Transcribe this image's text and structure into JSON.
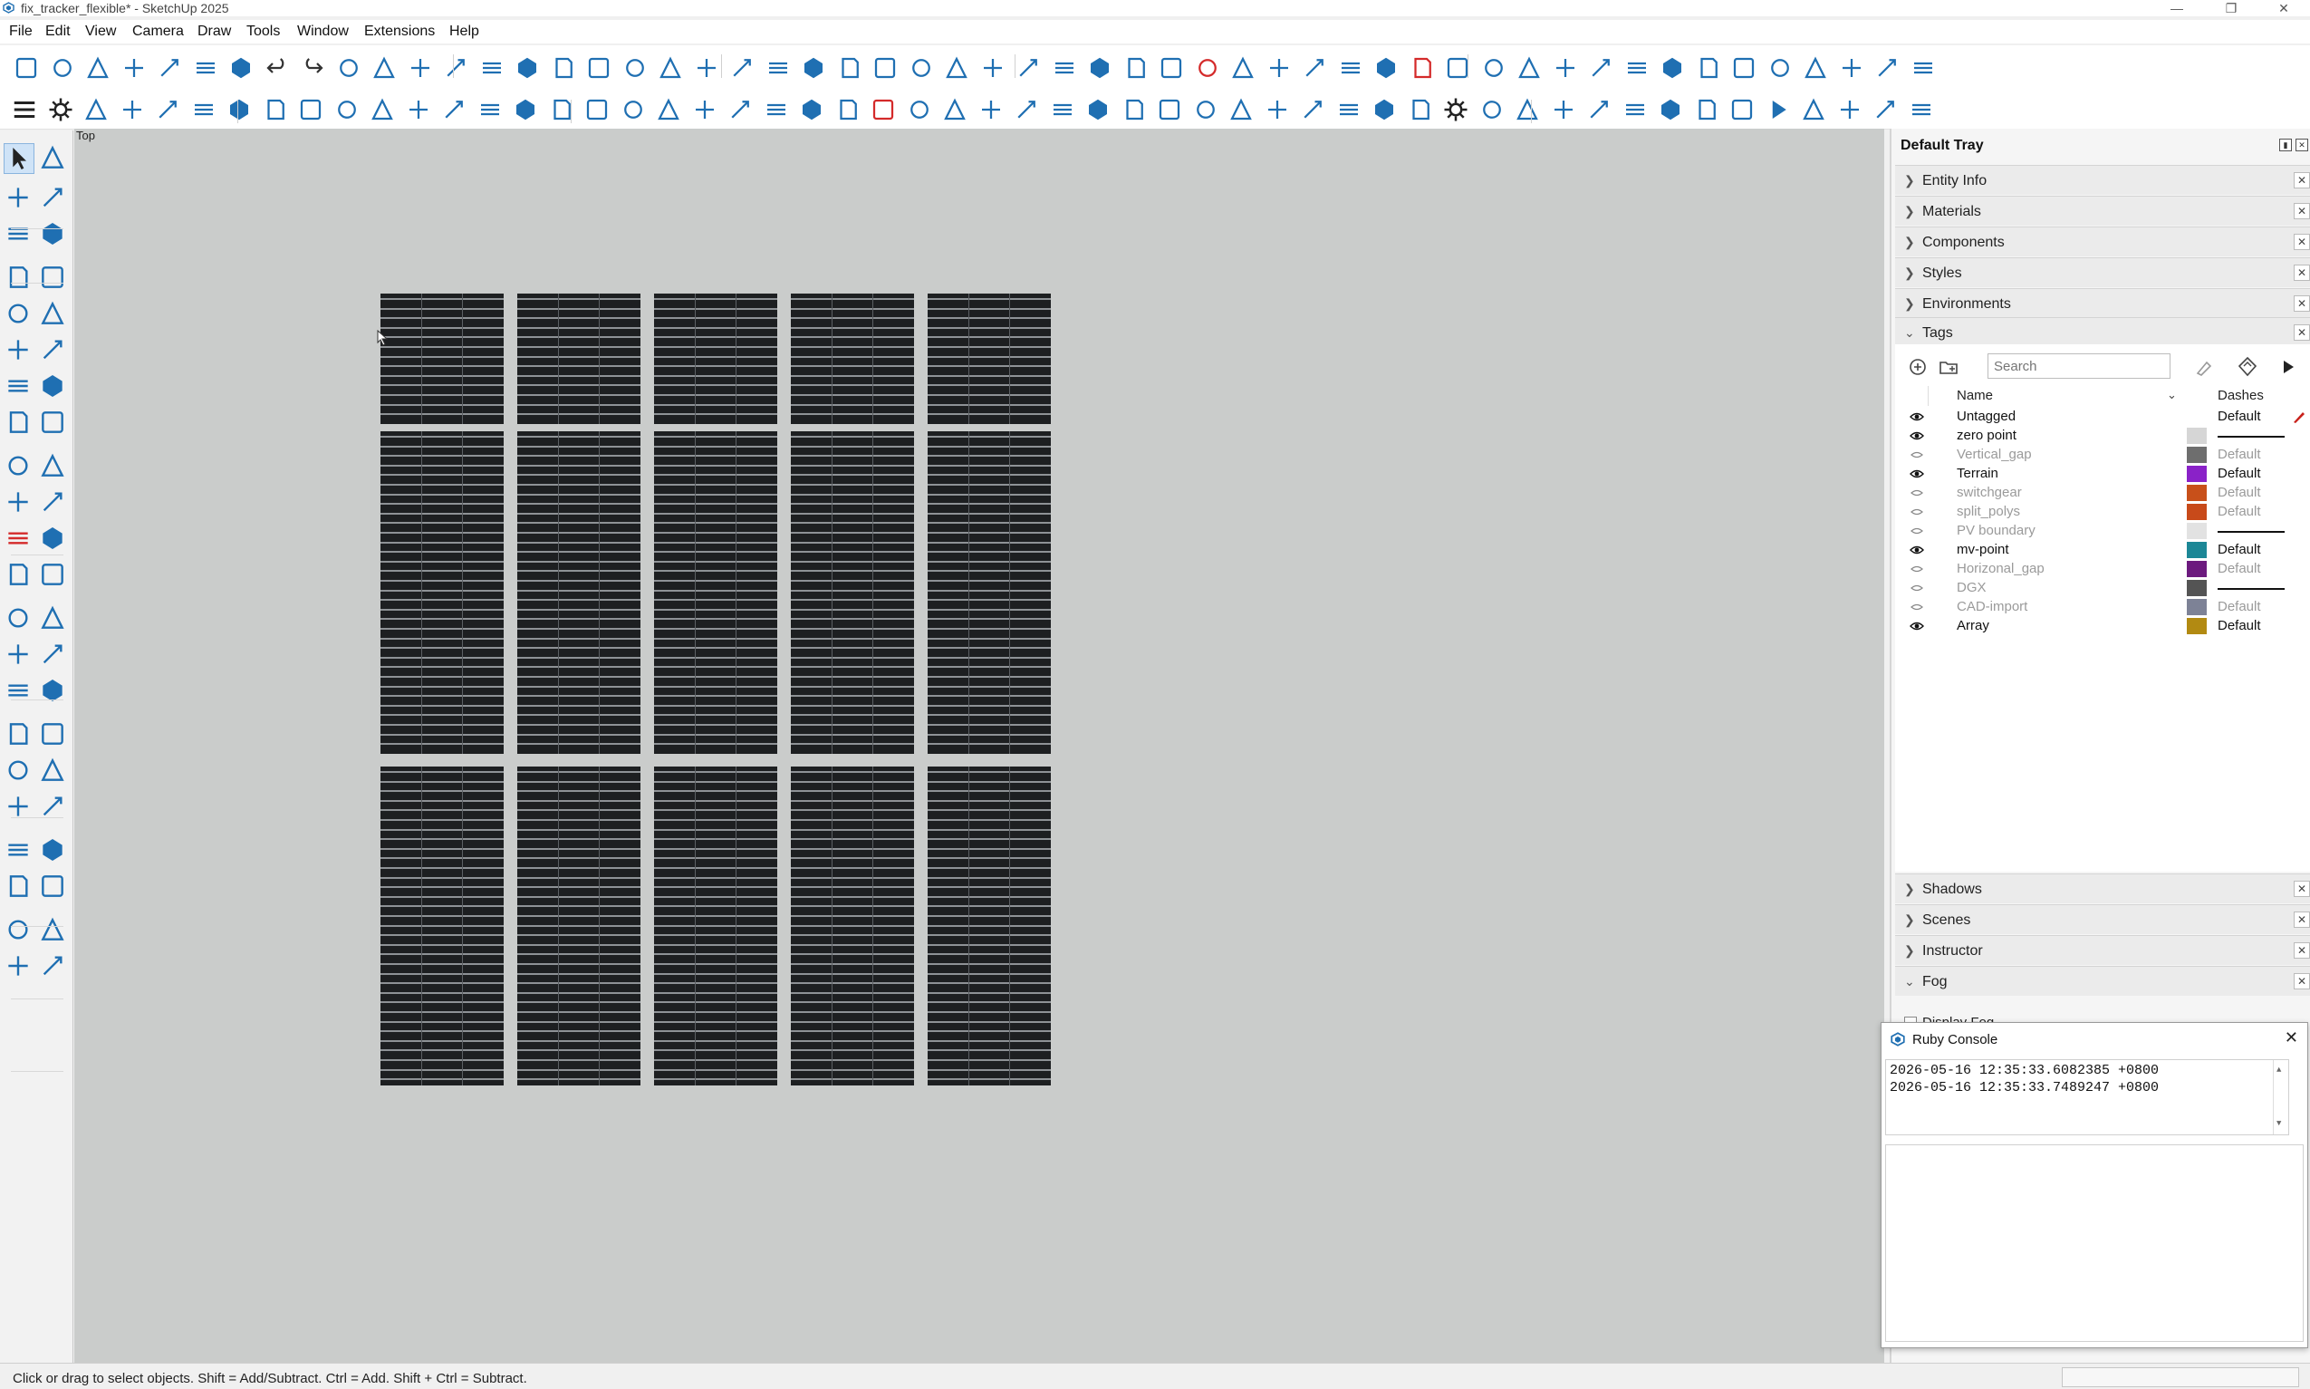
{
  "window": {
    "title": "fix_tracker_flexible* - SketchUp 2025",
    "controls": [
      "—",
      "❐",
      "✕"
    ]
  },
  "menu": [
    "File",
    "Edit",
    "View",
    "Camera",
    "Draw",
    "Tools",
    "Window",
    "Extensions",
    "Help"
  ],
  "colors": {
    "accent": "#1f6fb2",
    "viewport_bg": "#cacccb",
    "array_block": "#1d1f21",
    "red_tool": "#d42a2a"
  },
  "toolbar_icons": {
    "row1": [
      "new-file-icon",
      "open-file-icon",
      "save-icon",
      "cut-icon",
      "copy-icon",
      "paste-icon",
      "erase-icon",
      "undo-icon",
      "redo-icon",
      "print-icon",
      "model-info-icon",
      "iso-view-icon",
      "top-view-icon",
      "front-view-icon",
      "right-view-icon",
      "back-view-icon",
      "left-view-icon",
      "xray-icon",
      "back-edges-icon",
      "wireframe-icon",
      "hidden-line-icon",
      "shaded-icon",
      "shaded-textures-icon",
      "monochrome-icon",
      "warehouse-icon",
      "text-icon",
      "ext-tower-icon",
      "ext-pin-icon",
      "ext-windmill-icon",
      "ext-pylon-icon",
      "ext-cube-icon",
      "ext-grid-icon",
      "ext-frame-icon",
      "ext-scale-icon",
      "ext-hide-icon",
      "ext-triangle-icon",
      "ext-zoom-icon",
      "ext-angle-icon",
      "ext-height-icon",
      "ext-pencil-icon",
      "ext-swap-icon",
      "ext-stack-icon",
      "ext-lock-icon",
      "ext-slope-icon",
      "ext-tree-icon",
      "ext-truck-icon",
      "ext-table-icon",
      "ext-panel-icon",
      "ext-snow-icon",
      "ext-move-icon",
      "ext-auto-icon",
      "ext-arrow-icon",
      "ext-layout-icon",
      "ext-map-icon"
    ],
    "row2": [
      "menu-icon",
      "sun-icon",
      "globe-icon",
      "component-icon",
      "terrain-icon",
      "mountain-icon",
      "pv-icon",
      "pv-flat-icon",
      "grid-icon",
      "delete-icon",
      "percent-icon",
      "scatter-icon",
      "scatter2-icon",
      "cable-icon",
      "block-icon",
      "device-icon",
      "route-icon",
      "search-path-icon",
      "curve-icon",
      "search-s-icon",
      "anchor-icon",
      "link-icon",
      "rack-icon",
      "axis-icon",
      "scale-icon",
      "cad-icon",
      "cloud-icon",
      "ruler-icon",
      "branch-icon",
      "chart-icon",
      "shape-icon",
      "plus-move-icon",
      "calc-icon",
      "sliders-icon",
      "dropbox-icon",
      "database-icon",
      "stack-icon",
      "kwh-icon",
      "irr-icon",
      "clipboard-icon",
      "gear-icon",
      "users-icon",
      "en-icon",
      "help-icon",
      "upload-icon",
      "refresh-icon",
      "coins-icon",
      "loss-icon",
      "bi-icon",
      "play-icon",
      "explode-icon",
      "cross-tool-icon",
      "image-tool-icon",
      "obj-icon"
    ]
  },
  "left_tools": [
    "select-icon",
    "lasso-icon",
    "paint-bucket-icon",
    "eraser-icon",
    "tag-tool-icon",
    "tag-eraser-icon",
    "pencil-icon",
    "freehand-icon",
    "rectangle-icon",
    "rotated-rect-icon",
    "circle-icon",
    "polygon-icon",
    "arc-icon",
    "two-point-arc-icon",
    "three-point-arc-icon",
    "pie-icon",
    "move-icon",
    "push-pull-icon",
    "rotate-icon",
    "follow-me-icon",
    "scale-icon",
    "offset-icon",
    "axes-icon",
    "solid-tools-icon",
    "tape-measure-icon",
    "dimension-icon",
    "protractor-icon",
    "3d-text-icon",
    "section-plane-icon",
    "text-label-icon",
    "orbit-icon",
    "pan-icon",
    "zoom-icon",
    "zoom-window-icon",
    "zoom-extents-icon",
    "previous-view-icon",
    "position-camera-icon",
    "walk-icon",
    "look-around-icon",
    "sandbox-from-contours-icon",
    "sandbox-smoove-icon",
    "sandbox-stamp-icon",
    "sandbox-drape-icon",
    "sandbox-add-detail-icon"
  ],
  "viewport": {
    "label": "Top"
  },
  "tray": {
    "title": "Default Tray",
    "panels_top": [
      {
        "label": "Entity Info",
        "expanded": false
      },
      {
        "label": "Materials",
        "expanded": false
      },
      {
        "label": "Components",
        "expanded": false
      },
      {
        "label": "Styles",
        "expanded": false
      },
      {
        "label": "Environments",
        "expanded": false
      },
      {
        "label": "Tags",
        "expanded": true
      }
    ],
    "panels_bottom": [
      {
        "label": "Shadows",
        "expanded": false
      },
      {
        "label": "Scenes",
        "expanded": false
      },
      {
        "label": "Instructor",
        "expanded": false
      },
      {
        "label": "Fog",
        "expanded": true
      }
    ],
    "fog_checkbox_label": "Display Fog"
  },
  "tags": {
    "search_placeholder": "Search",
    "columns": {
      "name": "Name",
      "dashes": "Dashes"
    },
    "rows": [
      {
        "name": "Untagged",
        "visible": true,
        "color": "",
        "dashes": "Default",
        "active": true
      },
      {
        "name": "zero point",
        "visible": true,
        "color": "#d6d6d6",
        "dashes": "solid"
      },
      {
        "name": "Vertical_gap",
        "visible": false,
        "color": "#6e6e6e",
        "dashes": "Default"
      },
      {
        "name": "Terrain",
        "visible": true,
        "color": "#8a22c8",
        "dashes": "Default"
      },
      {
        "name": "switchgear",
        "visible": false,
        "color": "#c8501a",
        "dashes": "Default"
      },
      {
        "name": "split_polys",
        "visible": false,
        "color": "#c84a1a",
        "dashes": "Default"
      },
      {
        "name": "PV boundary",
        "visible": false,
        "color": "#e2e2e2",
        "dashes": "solid"
      },
      {
        "name": "mv-point",
        "visible": true,
        "color": "#1c8796",
        "dashes": "Default"
      },
      {
        "name": "Horizonal_gap",
        "visible": false,
        "color": "#6c1a7e",
        "dashes": "Default"
      },
      {
        "name": "DGX",
        "visible": false,
        "color": "#545454",
        "dashes": "solid"
      },
      {
        "name": "CAD-import",
        "visible": false,
        "color": "#7d8296",
        "dashes": "Default"
      },
      {
        "name": "Array",
        "visible": true,
        "color": "#b28a12",
        "dashes": "Default"
      }
    ]
  },
  "ruby_console": {
    "title": "Ruby Console",
    "lines": [
      "2026-05-16 12:35:33.6082385 +0800",
      "2026-05-16 12:35:33.7489247 +0800"
    ]
  },
  "status": {
    "text": "Click or drag to select objects. Shift = Add/Subtract. Ctrl = Add. Shift + Ctrl = Subtract."
  }
}
